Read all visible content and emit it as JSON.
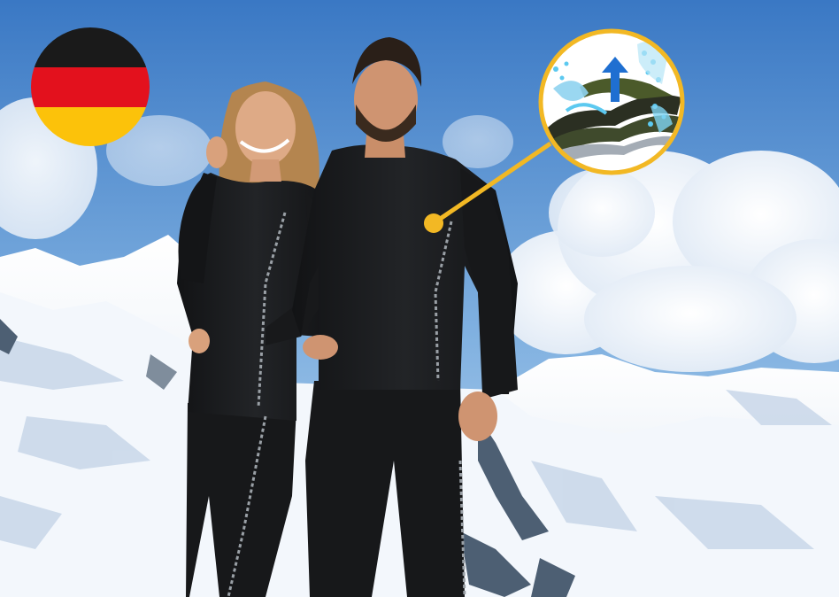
{
  "scene": {
    "description_free": true,
    "colors": {
      "sky_top": "#3f7fc8",
      "sky_bottom": "#9cc3e8",
      "snow": "#f4f7fb",
      "snow_shadow": "#b9cbe0",
      "rock": "#4d5f73",
      "garment": "#18191b",
      "garment_seam": "#9aa0a6",
      "callout": "#f2b824",
      "skin": "#d9a17c",
      "hair_woman": "#b88a55",
      "hair_man": "#2a1f18"
    }
  },
  "flag_badge": {
    "icon": "germany-flag-icon",
    "stripes": [
      "#1a1a1a",
      "#e3111d",
      "#fcc20a"
    ]
  },
  "callout": {
    "icon": "fabric-layer-icon",
    "ring_color": "#f2b824",
    "arrow_color": "#1f6fd1",
    "droplet_color": "#5cc9f0"
  }
}
